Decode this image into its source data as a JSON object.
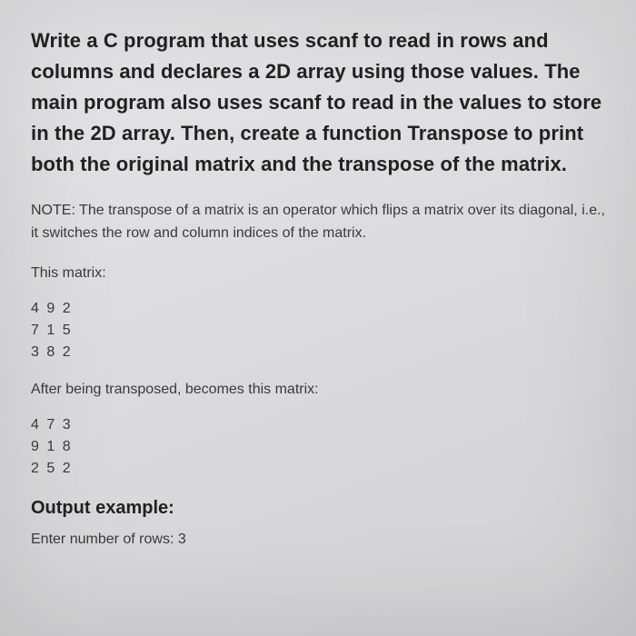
{
  "prompt": "Write a C program that uses scanf to read in rows and columns and declares a 2D array using those values. The main program also uses scanf to read in the values to store in the 2D array. Then, create a function Transpose to print both the original matrix and the transpose of the matrix.",
  "note": "NOTE: The transpose of a matrix is an operator which flips a matrix over its diagonal, i.e., it switches the row and column indices of the matrix.",
  "this_matrix_label": "This matrix:",
  "matrix_original": "4 9 2\n7 1 5\n3 8 2",
  "after_label": "After being transposed, becomes this matrix:",
  "matrix_transposed": "4 7 3\n9 1 8\n2 5 2",
  "output_heading": "Output example:",
  "output_line": "Enter number of rows: 3"
}
